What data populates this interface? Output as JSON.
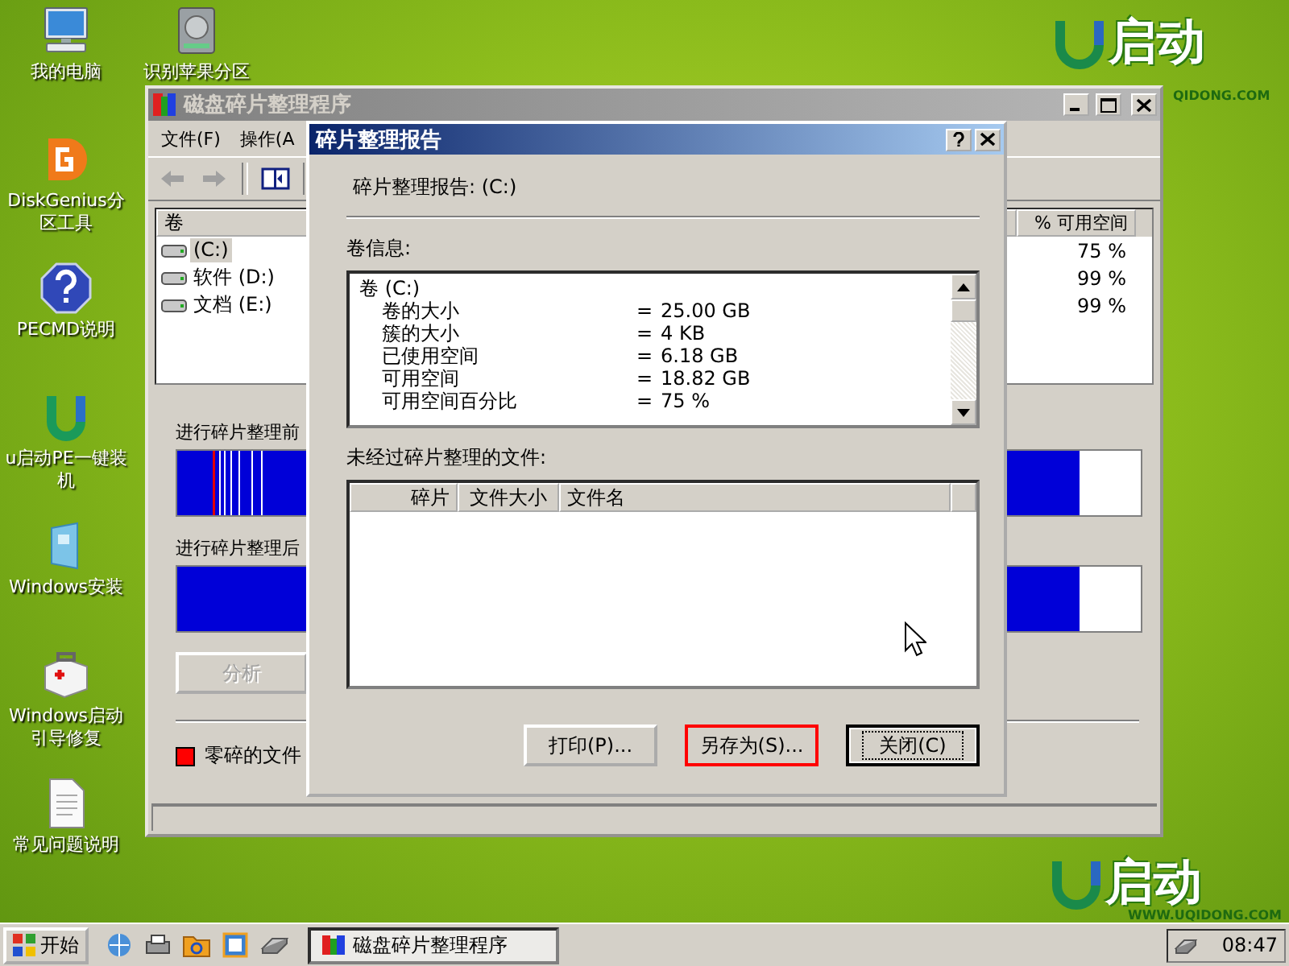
{
  "desktop_icons": [
    {
      "kind": "computer",
      "label": "我的电脑"
    },
    {
      "kind": "diskgenius",
      "label": "DiskGenius分区工具"
    },
    {
      "kind": "help",
      "label": "PECMD说明"
    },
    {
      "kind": "uqidong",
      "label": "u启动PE一键装机"
    },
    {
      "kind": "setup",
      "label": "Windows安装"
    },
    {
      "kind": "toolbox",
      "label": "Windows启动引导修复"
    },
    {
      "kind": "document",
      "label": "常见问题说明"
    },
    {
      "kind": "drive",
      "label": "识别苹果分区"
    }
  ],
  "logos": [
    {
      "text": "启动",
      "url": "QIDONG.COM"
    },
    {
      "text": "启动",
      "url": "WWW.UQIDONG.COM"
    }
  ],
  "main_window": {
    "title": "磁盘碎片整理程序",
    "menu": [
      "文件(F)",
      "操作(A"
    ],
    "volume_table": {
      "columns": [
        "卷",
        "% 可用空间"
      ],
      "rows": [
        {
          "volume": "(C:)",
          "free": "75 %",
          "selected": true
        },
        {
          "volume": "软件 (D:)",
          "free": "99 %",
          "selected": false
        },
        {
          "volume": "文档 (E:)",
          "free": "99 %",
          "selected": false
        }
      ]
    },
    "before_label": "进行碎片整理前",
    "after_label": "进行碎片整理后",
    "analyze_button": {
      "label": "分析",
      "disabled": true
    },
    "legend": [
      {
        "label": "零碎的文件",
        "color": "#ff0000"
      }
    ]
  },
  "dialog": {
    "title": "碎片整理报告",
    "heading": "碎片整理报告: (C:)",
    "volume_info_label": "卷信息:",
    "volume_info": [
      {
        "kind": "header",
        "label": "卷  (C:)"
      },
      {
        "kind": "field",
        "label": "卷的大小",
        "equals": "=",
        "value": "25.00 GB"
      },
      {
        "kind": "field",
        "label": "簇的大小",
        "equals": "=",
        "value": "4 KB"
      },
      {
        "kind": "field",
        "label": "已使用空间",
        "equals": "=",
        "value": "6.18 GB"
      },
      {
        "kind": "field",
        "label": "可用空间",
        "equals": "=",
        "value": "18.82 GB"
      },
      {
        "kind": "field",
        "label": "可用空间百分比",
        "equals": "=",
        "value": "75 %"
      }
    ],
    "files_label": "未经过碎片整理的文件:",
    "files_table": {
      "columns": [
        "碎片",
        "文件大小",
        "文件名"
      ]
    },
    "buttons": [
      {
        "label": "打印(P)...",
        "highlighted": false,
        "default": false
      },
      {
        "label": "另存为(S)...",
        "highlighted": true,
        "default": false
      },
      {
        "label": "关闭(C)",
        "highlighted": false,
        "default": true
      }
    ]
  },
  "taskbar": {
    "start": "开始",
    "tasks": [
      {
        "label": "磁盘碎片整理程序",
        "selected": true
      }
    ],
    "clock": "08:47"
  }
}
